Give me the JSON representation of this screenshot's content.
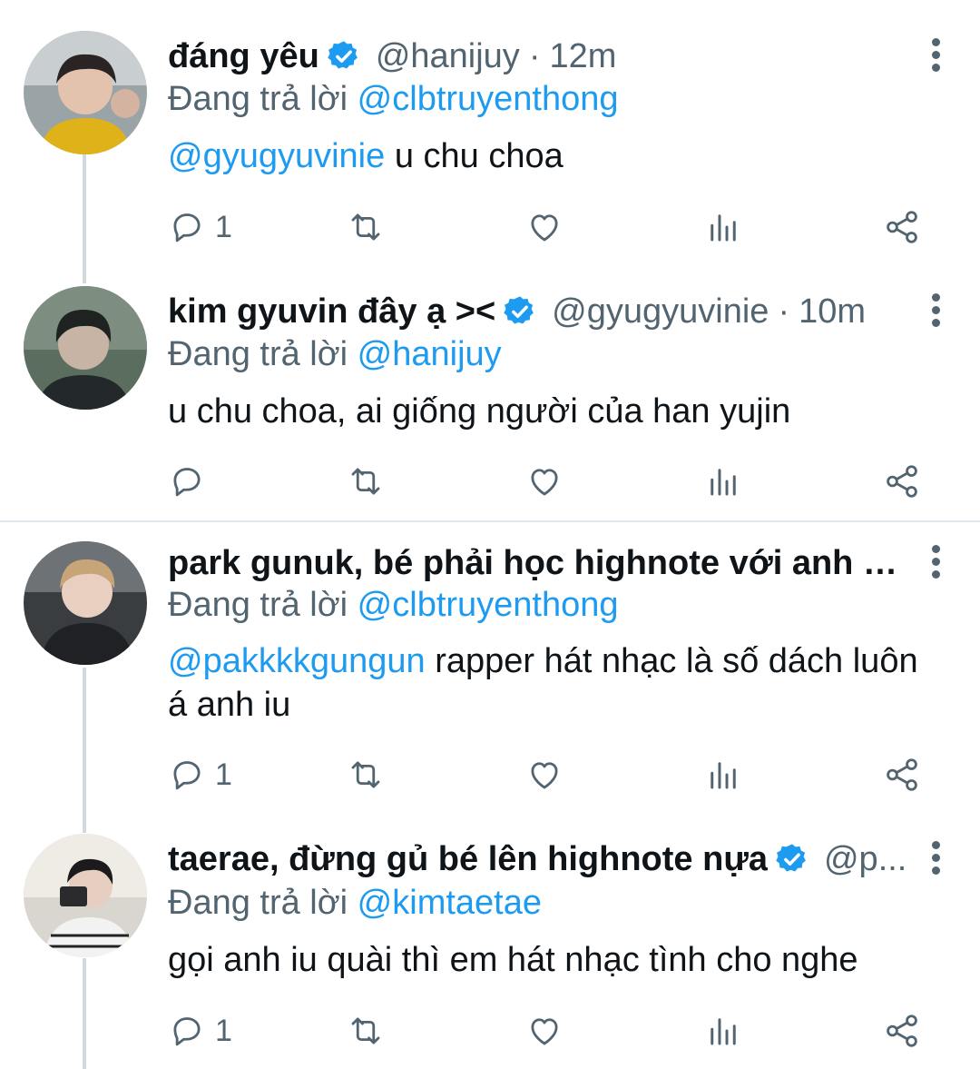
{
  "colors": {
    "accent": "#1d9bf0",
    "secondary": "#536471",
    "text": "#0f1419",
    "divider": "#e1e8ed",
    "thread": "#cfd9de"
  },
  "icons": {
    "verified": "verified-badge-icon",
    "more": "more-vertical-icon",
    "reply": "reply-icon",
    "retweet": "retweet-icon",
    "like": "heart-icon",
    "views": "analytics-icon",
    "share": "share-icon"
  },
  "tweets": [
    {
      "name": "đáng yêu",
      "handle": "@hanijuy",
      "sep": "·",
      "time": "12m",
      "replying_prefix": "Đang trả lời",
      "replying_to": "@clbtruyenthong",
      "body_mention": "@gyugyuvinie",
      "body_text": " u chu choa",
      "reply_count": "1"
    },
    {
      "name": "kim gyuvin đây ạ ><",
      "handle": "@gyugyuvinie",
      "sep": "·",
      "time": "10m",
      "replying_prefix": "Đang trả lời",
      "replying_to": "@hanijuy",
      "body_mention": "",
      "body_text": "u chu choa, ai giống người của han yujin",
      "reply_count": ""
    },
    {
      "name": "park gunuk, bé phải học highnote với anh c...",
      "replying_prefix": "Đang trả lời",
      "replying_to": "@clbtruyenthong",
      "body_mention": "@pakkkkgungun",
      "body_text": " rapper hát nhạc là số dách luôn á anh iu",
      "reply_count": "1"
    },
    {
      "name": "taerae, đừng gủ bé lên highnote nựa",
      "handle": "@p...",
      "replying_prefix": "Đang trả lời",
      "replying_to": "@kimtaetae",
      "body_mention": "",
      "body_text": "gọi anh iu quài thì em hát nhạc tình cho nghe",
      "reply_count": "1"
    }
  ]
}
